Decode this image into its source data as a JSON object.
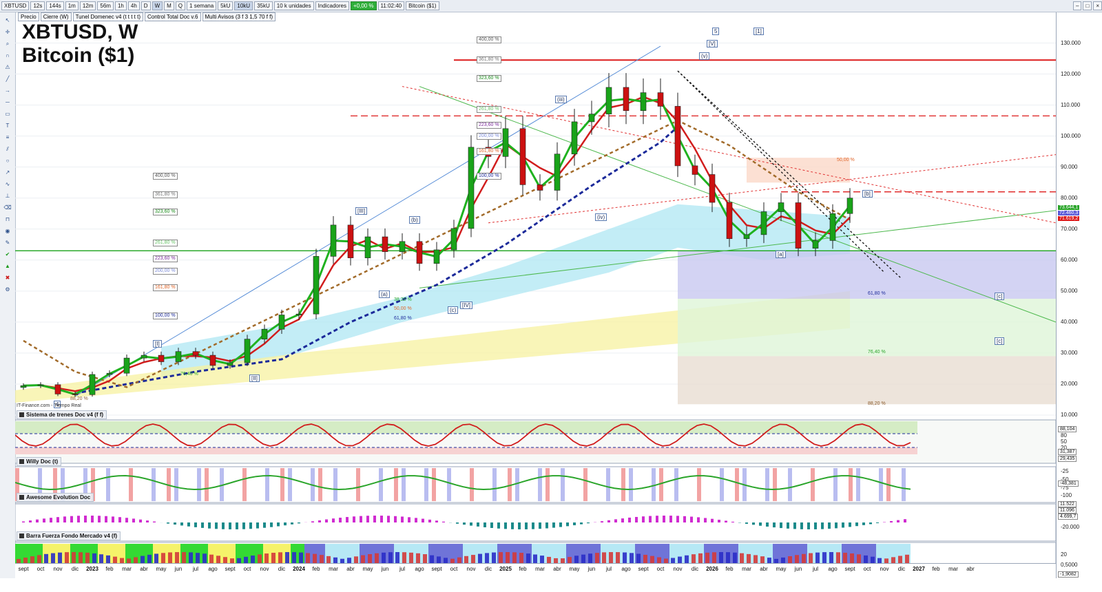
{
  "toolbar": {
    "symbol": "XBTUSD",
    "timeframes": [
      "12s",
      "144s",
      "1m",
      "12m",
      "56m",
      "1h",
      "4h",
      "D",
      "W",
      "M",
      "Q"
    ],
    "selected_timeframe": "W",
    "period": "1 semana",
    "volume_bars": [
      "5kU",
      "10kU",
      "35kU"
    ],
    "selected_volume": "10kU",
    "units": "10 k unidades",
    "indicators_label": "Indicadores",
    "change_badge": "+0,00 %",
    "clock": "11:02:40",
    "instrument": "Bitcoin ($1)"
  },
  "legend": {
    "price": "Precio",
    "close": "Cierre (W)",
    "tunnel": "Tunel Domenec v4 (t t t t t)",
    "control": "Control Total Doc v.6",
    "alerts": "Multi Avisos (3 f 3 1,5 70 f f)"
  },
  "title": {
    "line1": "XBTUSD, W",
    "line2": "Bitcoin ($1)"
  },
  "watermark": "IT-Finance.com - Tiempo Real",
  "colors": {
    "up": "#19a319",
    "down": "#cc1111",
    "neutral": "#e6d21a",
    "accent": "#2647a8",
    "fast_ma": "#1fb21f",
    "slow_ma": "#d11d1d"
  },
  "chart_data": [
    {
      "type": "line",
      "name_shown": "Bitcoin ($1)",
      "x": [
        "2022-09",
        "2022-10",
        "2022-11",
        "2022-12",
        "2023-01",
        "2023-02",
        "2023-03",
        "2023-04",
        "2023-05",
        "2023-06",
        "2023-07",
        "2023-08",
        "2023-09",
        "2023-10",
        "2023-11",
        "2023-12",
        "2024-01",
        "2024-02",
        "2024-03",
        "2024-04",
        "2024-05",
        "2024-06",
        "2024-07",
        "2024-08",
        "2024-09",
        "2024-10",
        "2024-11",
        "2024-12",
        "2025-01",
        "2025-02",
        "2025-03",
        "2025-04",
        "2025-05",
        "2025-06",
        "2025-07",
        "2025-08",
        "2025-09",
        "2025-10",
        "2025-11",
        "2025-12",
        "2026-01",
        "2026-02",
        "2026-03",
        "2026-04",
        "2026-05",
        "2026-06",
        "2026-07",
        "2026-08",
        "2026-09"
      ],
      "y": [
        19500,
        19800,
        16800,
        16600,
        23100,
        23500,
        28400,
        29300,
        27200,
        30500,
        29300,
        26000,
        26900,
        34500,
        37700,
        42300,
        42600,
        61200,
        71300,
        60700,
        67500,
        62700,
        66000,
        58900,
        63300,
        70200,
        96400,
        93400,
        102400,
        84300,
        82500,
        94200,
        104600,
        107100,
        115700,
        108200,
        114000,
        109600,
        90400,
        87600,
        78600,
        66900,
        68200,
        75600,
        78500,
        63800,
        66300,
        75000,
        80000
      ],
      "xlabel": "",
      "ylabel": "",
      "ylim": [
        10000,
        135000
      ],
      "y_ticks": [
        "130.000",
        "120.000",
        "110.000",
        "100.000",
        "90.000",
        "80.000",
        "70.000",
        "60.000",
        "50.000",
        "40.000",
        "30.000",
        "20.000",
        "10.000"
      ],
      "y_tick_values": [
        130000,
        120000,
        110000,
        100000,
        90000,
        80000,
        70000,
        60000,
        50000,
        40000,
        30000,
        20000,
        10000
      ],
      "price_labels": [
        "73.644,1",
        "72.460,3",
        "71.619,2"
      ],
      "horizontal_levels": [
        124500,
        106500,
        82000,
        63000
      ],
      "fib_left": [
        "400,00 %",
        "361,80 %",
        "323,60 %",
        "261,80 %",
        "223,60 %",
        "200,00 %",
        "161,80 %",
        "100,00 %"
      ],
      "fib_mid": [
        "400,00 %",
        "361,80 %",
        "323,60 %",
        "261,80 %",
        "223,60 %",
        "200,00 %",
        "161,80 %",
        "100,00 %"
      ],
      "retrace_labels": [
        "38,20 %",
        "50,00 %",
        "61,80 %",
        "76,40 %",
        "88,20 %"
      ],
      "right_retrace_labels": [
        "50,00 %",
        "61,80 %",
        "76,40 %",
        "88,20 %"
      ],
      "waves": [
        "4",
        "[I]",
        "[II]",
        "(a)",
        "(b)",
        "(c)",
        "[III]",
        "[IV]",
        "(iii)",
        "(iv)",
        "(v)",
        "[V]",
        "5",
        "[1]",
        "[a]",
        "[b]",
        "[c]",
        "[c]"
      ],
      "grid": true,
      "legend": "none"
    },
    {
      "type": "line",
      "title": "Sistema de trenes Doc v4 (f f)",
      "y_ticks": [
        "80",
        "50",
        "20"
      ],
      "value_labels": [
        "88,104",
        "31,387",
        "29,435"
      ]
    },
    {
      "type": "line",
      "title": "Willy Doc (t)",
      "y_ticks": [
        "-25",
        "-50",
        "-75",
        "-100"
      ],
      "value_labels": [
        "-48,381"
      ]
    },
    {
      "type": "bar",
      "title": "Awesome Evolution Doc",
      "y_ticks": [
        "-20.000"
      ],
      "value_labels": [
        "11.522",
        "11.096",
        "4.699,7"
      ]
    },
    {
      "type": "bar",
      "title": "Barra Fuerza Fondo Mercado v4 (f)",
      "y_ticks": [
        "20",
        "0,5000"
      ],
      "value_labels": [
        "-1,9082"
      ]
    }
  ],
  "x_axis": [
    "sept",
    "oct",
    "nov",
    "dic",
    "2023",
    "feb",
    "mar",
    "abr",
    "may",
    "jun",
    "jul",
    "ago",
    "sept",
    "oct",
    "nov",
    "dic",
    "2024",
    "feb",
    "mar",
    "abr",
    "may",
    "jun",
    "jul",
    "ago",
    "sept",
    "oct",
    "nov",
    "dic",
    "2025",
    "feb",
    "mar",
    "abr",
    "may",
    "jun",
    "jul",
    "ago",
    "sept",
    "oct",
    "nov",
    "dic",
    "2026",
    "feb",
    "mar",
    "abr",
    "may",
    "jun",
    "jul",
    "ago",
    "sept",
    "oct",
    "nov",
    "dic",
    "2027",
    "feb",
    "mar",
    "abr"
  ]
}
